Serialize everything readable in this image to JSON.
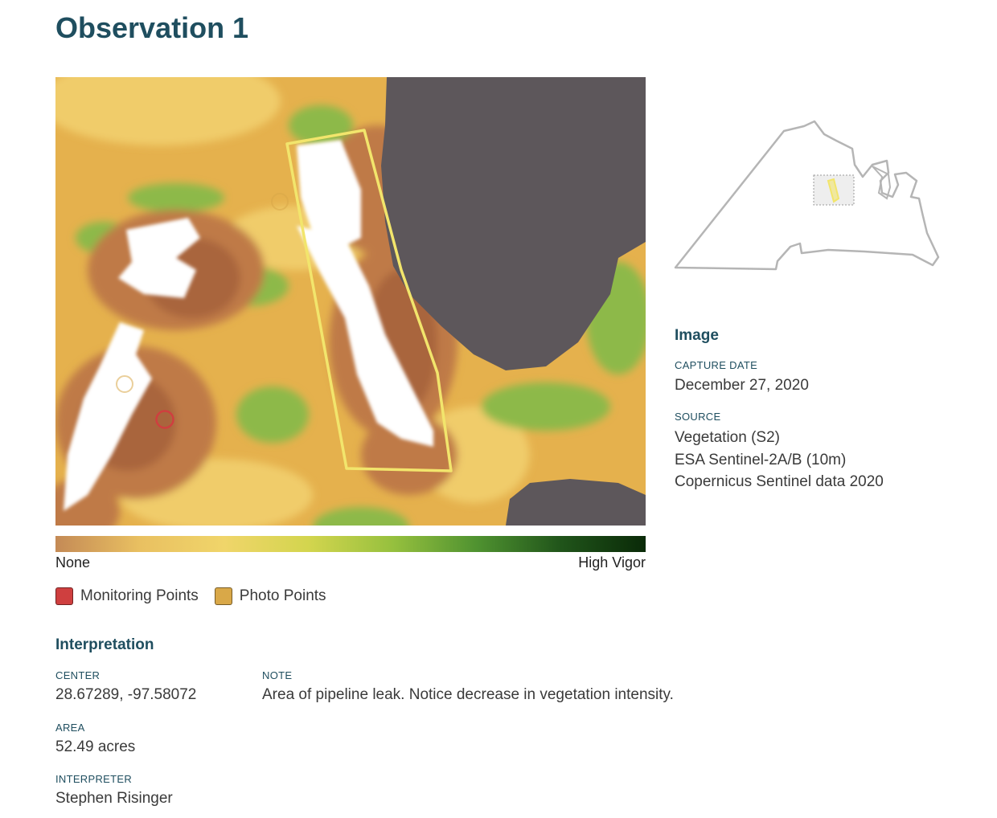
{
  "page": {
    "title": "Observation 1"
  },
  "map": {
    "colors": {
      "base": "#e5b14d",
      "low_brown": "#bf7a47",
      "dark_brown": "#a9653e",
      "bright_yellow": "#f0cc6a",
      "green": "#8db94a",
      "dark_green": "#6ea33b",
      "bare_white": "#ffffff",
      "masked": "#5d575b",
      "boundary": "#f2e56c",
      "monitoring_point": "#cf3f3f",
      "photo_point": "#d9a848"
    },
    "icons": [
      "boundary-polygon-icon",
      "monitoring-point-icon",
      "photo-point-icon"
    ]
  },
  "scale": {
    "low_label": "None",
    "high_label": "High Vigor",
    "gradient": [
      "#c48a56",
      "#e9c061",
      "#f0d56a",
      "#d3d54e",
      "#96c03e",
      "#4f9230",
      "#20541a",
      "#0a2a08"
    ]
  },
  "legend": {
    "items": [
      {
        "label": "Monitoring Points",
        "color": "#cf3f3f"
      },
      {
        "label": "Photo Points",
        "color": "#d9a848"
      }
    ]
  },
  "image_info": {
    "heading": "Image",
    "capture_date_label": "CAPTURE DATE",
    "capture_date": "December 27, 2020",
    "source_label": "SOURCE",
    "source_lines": [
      "Vegetation (S2)",
      "ESA Sentinel-2A/B (10m)",
      "Copernicus Sentinel data 2020"
    ]
  },
  "interpretation": {
    "heading": "Interpretation",
    "center_label": "CENTER",
    "center": "28.67289, -97.58072",
    "area_label": "AREA",
    "area": "52.49 acres",
    "interpreter_label": "INTERPRETER",
    "interpreter": "Stephen Risinger",
    "note_label": "NOTE",
    "note": "Area of pipeline leak. Notice decrease in vegetation intensity."
  }
}
